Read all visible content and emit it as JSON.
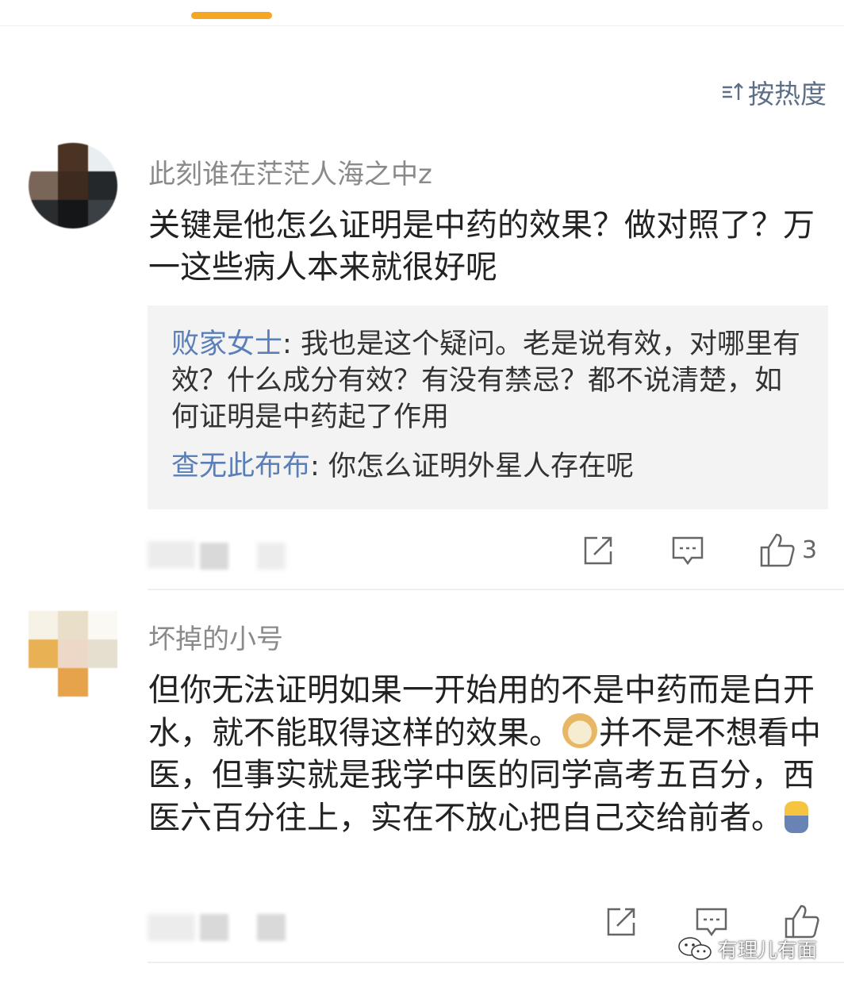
{
  "sort": {
    "label": "按热度"
  },
  "comments": [
    {
      "username": "此刻谁在茫茫人海之中z",
      "text": "关键是他怎么证明是中药的效果？做对照了？万一这些病人本来就很好呢",
      "replies": [
        {
          "user": "败家女士",
          "sep": ": ",
          "text": "我也是这个疑问。老是说有效，对哪里有效？什么成分有效？有没有禁忌？都不说清楚，如何证明是中药起了作用"
        },
        {
          "user": "查无此布布",
          "sep": ": ",
          "text": "你怎么证明外星人存在呢"
        }
      ],
      "likes": "3"
    },
    {
      "username": "坏掉的小号",
      "text_part1": "但你无法证明如果一开始用的不是中药而是白开水，就不能取得这样的效果。",
      "text_part2": "并不是不想看中医，但事实就是我学中医的同学高考五百分，西医六百分往上，实在不放心把自己交给前者。",
      "likes": ""
    }
  ],
  "watermark": {
    "text": "有理儿有面"
  },
  "icons": [
    "sort-icon",
    "share-icon",
    "comment-icon",
    "like-icon",
    "wechat-icon"
  ]
}
